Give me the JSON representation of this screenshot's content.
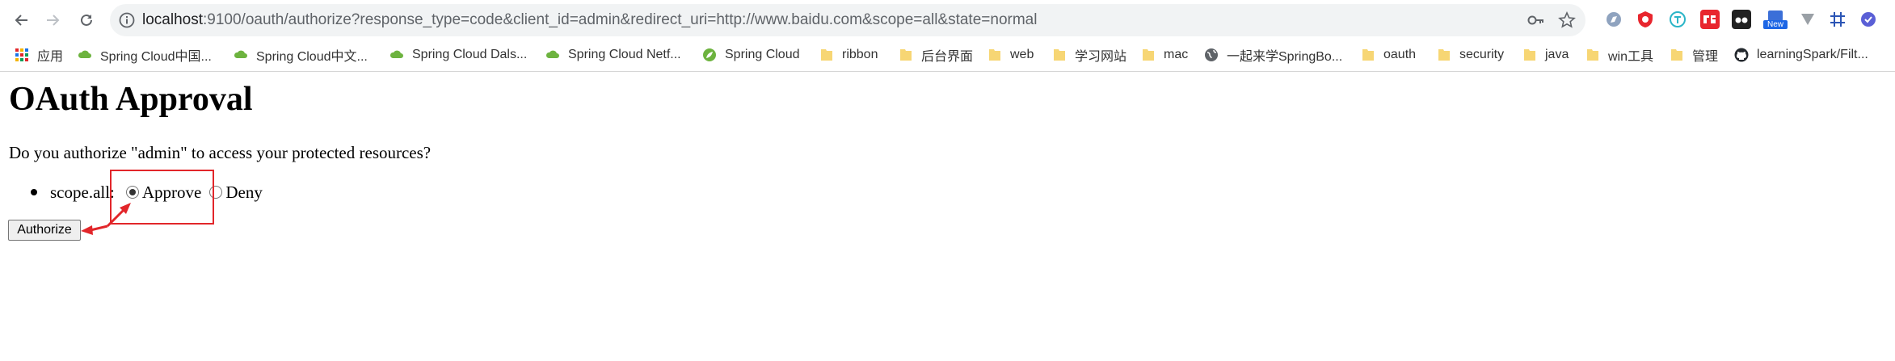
{
  "browser": {
    "url_host": "localhost",
    "url_rest": ":9100/oauth/authorize?response_type=code&client_id=admin&redirect_uri=http://www.baidu.com&scope=all&state=normal",
    "ext_new_badge": "New"
  },
  "bookmarks": [
    {
      "label": "应用",
      "icon": "apps-grid-icon"
    },
    {
      "label": "Spring Cloud中国...",
      "icon": "spring-cloud-icon"
    },
    {
      "label": "Spring Cloud中文...",
      "icon": "spring-cloud-icon"
    },
    {
      "label": "Spring Cloud Dals...",
      "icon": "spring-cloud-icon"
    },
    {
      "label": "Spring Cloud Netf...",
      "icon": "spring-cloud-icon"
    },
    {
      "label": "Spring Cloud",
      "icon": "spring-leaf-icon"
    },
    {
      "label": "ribbon",
      "icon": "folder-icon"
    },
    {
      "label": "后台界面",
      "icon": "folder-icon"
    },
    {
      "label": "web",
      "icon": "folder-icon"
    },
    {
      "label": "学习网站",
      "icon": "folder-icon"
    },
    {
      "label": "mac",
      "icon": "folder-icon"
    },
    {
      "label": "一起来学SpringBo...",
      "icon": "globe-icon"
    },
    {
      "label": "oauth",
      "icon": "folder-icon"
    },
    {
      "label": "security",
      "icon": "folder-icon"
    },
    {
      "label": "java",
      "icon": "folder-icon"
    },
    {
      "label": "win工具",
      "icon": "folder-icon"
    },
    {
      "label": "管理",
      "icon": "folder-icon"
    },
    {
      "label": "learningSpark/Filt...",
      "icon": "github-icon"
    }
  ],
  "page": {
    "title": "OAuth Approval",
    "question": "Do you authorize \"admin\" to access your protected resources?",
    "scope_label": "scope.all:",
    "approve_label": "Approve",
    "deny_label": "Deny",
    "authorize_button": "Authorize"
  },
  "colors": {
    "annotation": "#e2262a",
    "omnibox_bg": "#f1f3f4",
    "folder": "#f7d674"
  }
}
